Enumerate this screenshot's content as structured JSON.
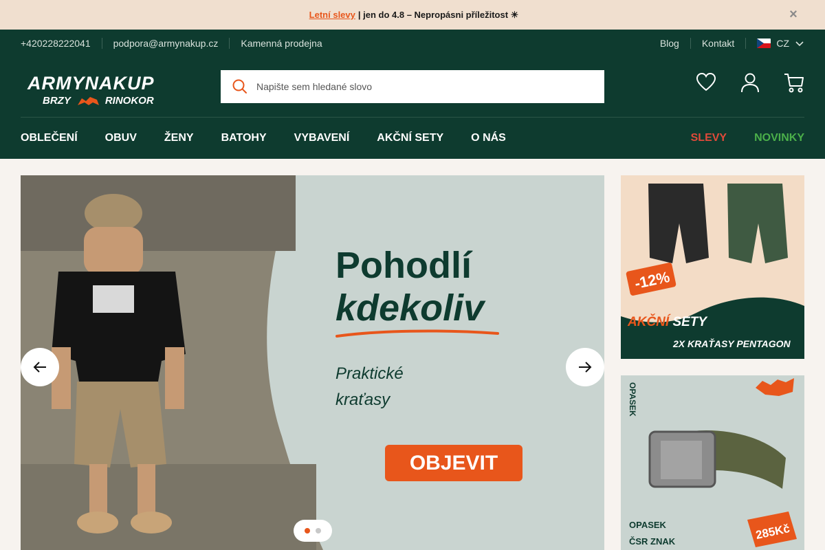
{
  "promo": {
    "icon": "",
    "link": "Letní slevy",
    "text": "| jen do 4.8 – Nepropásni příležitost ☀",
    "close_icon": "close-icon"
  },
  "topbar": {
    "phone": "+420228222041",
    "email": "podpora@armynakup.cz",
    "store": "Kamenná prodejna",
    "blog": "Blog",
    "contact": "Kontakt",
    "lang": "CZ"
  },
  "logo": {
    "line1": "ARMYNAKUP",
    "line2a": "BRZY",
    "line2b": "RINOKOR"
  },
  "search": {
    "placeholder": "Napište sem hledané slovo"
  },
  "nav": {
    "items": [
      "OBLEČENÍ",
      "OBUV",
      "ŽENY",
      "BATOHY",
      "VYBAVENÍ",
      "AKČNÍ SETY",
      "O NÁS"
    ],
    "sale": "SLEVY",
    "new": "NOVINKY"
  },
  "hero": {
    "line1": "Pohodlí",
    "line2": "kdekoliv",
    "line3": "Praktické",
    "line4": "kraťasy",
    "cta": "OBJEVIT",
    "current_slide": 1,
    "slide_count": 2
  },
  "banner1": {
    "discount": "-12%",
    "title_a": "AKČNÍ",
    "title_b": "SETY",
    "subtitle": "2X KRAŤASY PENTAGON"
  },
  "banner2": {
    "side": "OPASEK",
    "title1": "OPASEK",
    "title2": "ČSR ZNAK",
    "price": "285Kč"
  },
  "colors": {
    "brand_green": "#0e3b2f",
    "accent_orange": "#e8561b",
    "sale_red": "#e04a3a",
    "new_green": "#4bb04a"
  }
}
